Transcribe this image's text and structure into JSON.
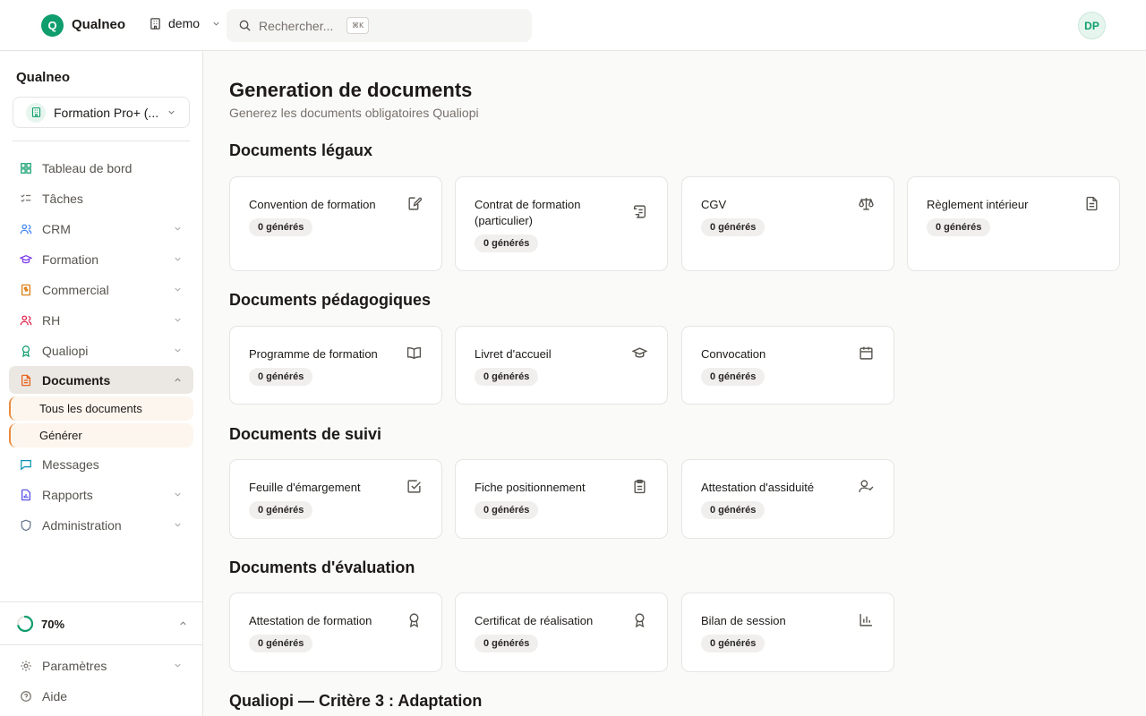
{
  "topbar": {
    "logo_letter": "Q",
    "brand": "Qualneo",
    "workspace": "demo",
    "search_placeholder": "Rechercher...",
    "shortcut": "⌘K",
    "avatar_initials": "DP"
  },
  "sidebar": {
    "title": "Qualneo",
    "org": "Formation Pro+ (...",
    "items": [
      {
        "label": "Tableau de bord",
        "icon": "dashboard-icon"
      },
      {
        "label": "Tâches",
        "icon": "tasks-icon"
      },
      {
        "label": "CRM",
        "icon": "users-icon"
      },
      {
        "label": "Formation",
        "icon": "graduation-cap-icon"
      },
      {
        "label": "Commercial",
        "icon": "receipt-icon"
      },
      {
        "label": "RH",
        "icon": "people-icon"
      },
      {
        "label": "Qualiopi",
        "icon": "award-icon"
      },
      {
        "label": "Documents",
        "icon": "document-icon"
      },
      {
        "label": "Messages",
        "icon": "message-icon"
      },
      {
        "label": "Rapports",
        "icon": "report-icon"
      },
      {
        "label": "Administration",
        "icon": "shield-icon"
      }
    ],
    "sub_items": [
      "Tous les documents",
      "Générer"
    ],
    "progress_label": "70%",
    "progress_value": 0.7,
    "bottom_items": [
      {
        "label": "Paramètres",
        "icon": "gear-icon"
      },
      {
        "label": "Aide",
        "icon": "help-icon"
      }
    ]
  },
  "main": {
    "title": "Generation de documents",
    "subtitle": "Generez les documents obligatoires Qualiopi",
    "sections": [
      {
        "title": "Documents légaux",
        "cards": [
          {
            "title": "Convention de formation",
            "badge": "0 générés",
            "icon": "edit-document-icon"
          },
          {
            "title": "Contrat de formation (particulier)",
            "badge": "0 générés",
            "icon": "scroll-icon"
          },
          {
            "title": "CGV",
            "badge": "0 générés",
            "icon": "scale-icon"
          },
          {
            "title": "Règlement intérieur",
            "badge": "0 générés",
            "icon": "file-text-icon"
          }
        ]
      },
      {
        "title": "Documents pédagogiques",
        "cards": [
          {
            "title": "Programme de formation",
            "badge": "0 générés",
            "icon": "book-open-icon"
          },
          {
            "title": "Livret d'accueil",
            "badge": "0 générés",
            "icon": "graduation-cap-icon"
          },
          {
            "title": "Convocation",
            "badge": "0 générés",
            "icon": "calendar-icon"
          }
        ]
      },
      {
        "title": "Documents de suivi",
        "cards": [
          {
            "title": "Feuille d'émargement",
            "badge": "0 générés",
            "icon": "check-square-icon"
          },
          {
            "title": "Fiche positionnement",
            "badge": "0 générés",
            "icon": "clipboard-icon"
          },
          {
            "title": "Attestation d'assiduité",
            "badge": "0 générés",
            "icon": "user-check-icon"
          }
        ]
      },
      {
        "title": "Documents d'évaluation",
        "cards": [
          {
            "title": "Attestation de formation",
            "badge": "0 générés",
            "icon": "award-icon"
          },
          {
            "title": "Certificat de réalisation",
            "badge": "0 générés",
            "icon": "award-icon"
          },
          {
            "title": "Bilan de session",
            "badge": "0 générés",
            "icon": "bar-chart-icon"
          }
        ]
      },
      {
        "title": "Qualiopi — Critère 3 : Adaptation",
        "cards": []
      }
    ]
  },
  "colors": {
    "brand": "#0f9d6e",
    "accent": "#ea8a3d",
    "active_nav": "#ebe8e4"
  }
}
